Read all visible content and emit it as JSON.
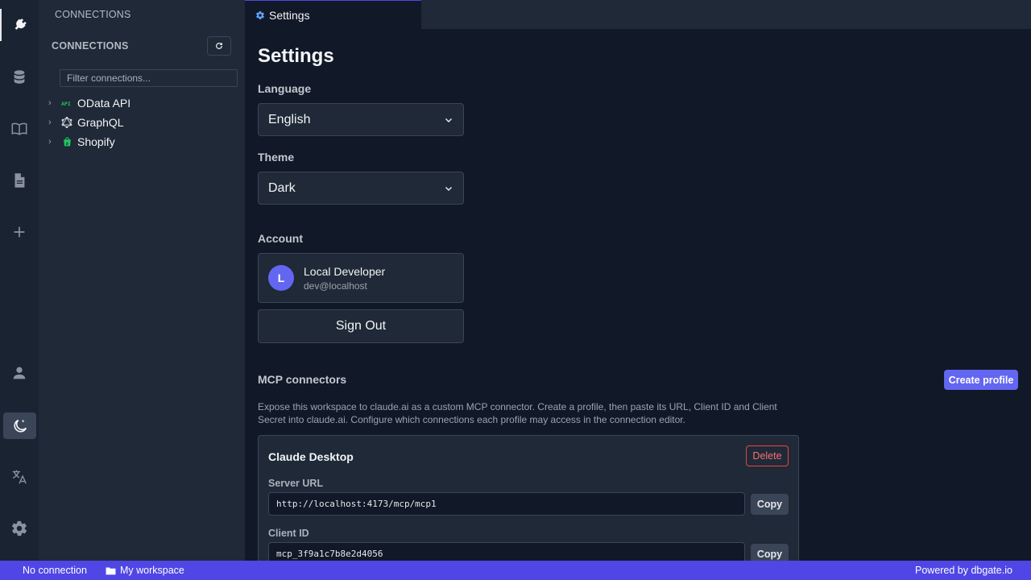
{
  "sidebar": {
    "title": "CONNECTIONS",
    "header": "CONNECTIONS",
    "filter_placeholder": "Filter connections...",
    "connections": [
      {
        "label": "OData API",
        "icon": "api-icon"
      },
      {
        "label": "GraphQL",
        "icon": "graphql-icon"
      },
      {
        "label": "Shopify",
        "icon": "shopify-icon"
      }
    ]
  },
  "tab": {
    "label": "Settings",
    "icon": "gear-icon"
  },
  "settings": {
    "title": "Settings",
    "language_label": "Language",
    "language_value": "English",
    "theme_label": "Theme",
    "theme_value": "Dark",
    "account_label": "Account",
    "account": {
      "initial": "L",
      "name": "Local Developer",
      "email": "dev@localhost"
    },
    "sign_out": "Sign Out"
  },
  "mcp": {
    "title": "MCP connectors",
    "create_button": "Create profile",
    "description": "Expose this workspace to claude.ai as a custom MCP connector. Create a profile, then paste its URL, Client ID and Client Secret into claude.ai. Configure which connections each profile may access in the connection editor.",
    "profile": {
      "name": "Claude Desktop",
      "delete_button": "Delete",
      "server_url_label": "Server URL",
      "server_url": "http://localhost:4173/mcp/mcp1",
      "client_id_label": "Client ID",
      "client_id": "mcp_3f9a1c7b8e2d4056",
      "copy_label": "Copy"
    }
  },
  "statusbar": {
    "connection": "No connection",
    "workspace": "My workspace",
    "powered_by": "Powered by dbgate.io"
  },
  "colors": {
    "accent": "#4f46e5",
    "avatar": "#6366f1",
    "danger": "#ef4444",
    "shopify": "#22c55e",
    "api": "#22c55e"
  }
}
